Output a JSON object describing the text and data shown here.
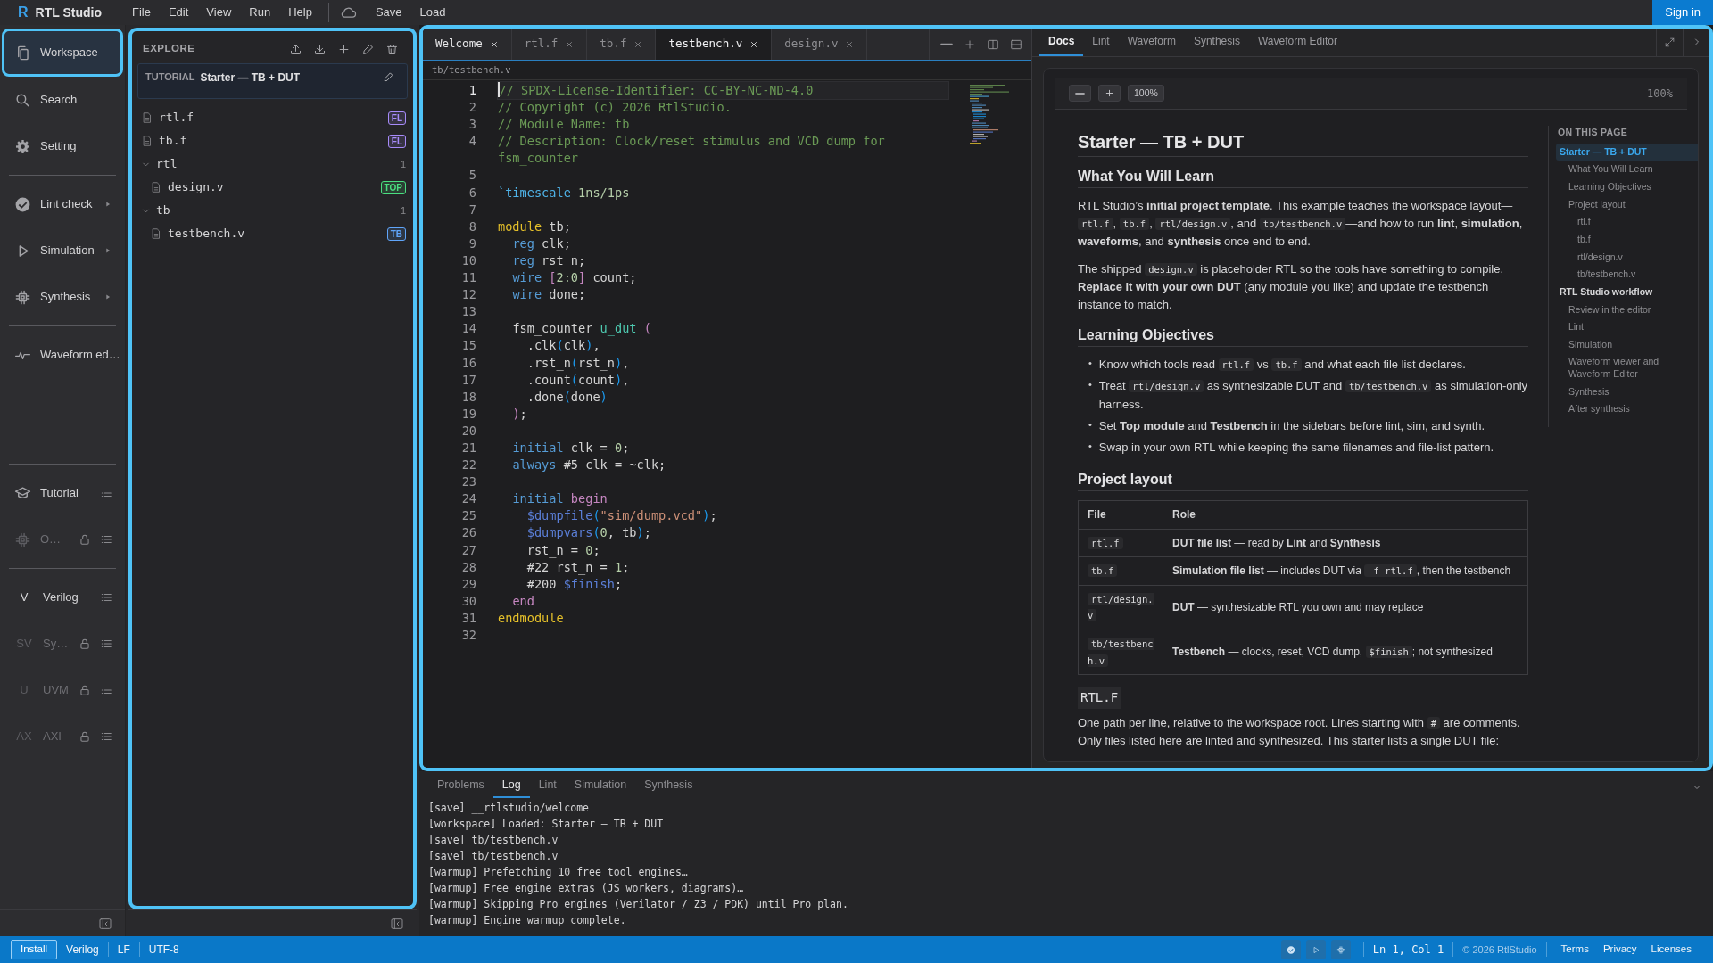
{
  "menubar": {
    "logo_mark": "R",
    "app_title": "RTL Studio",
    "menus": [
      "File",
      "Edit",
      "View",
      "Run",
      "Help"
    ],
    "actions": [
      "Save",
      "Load"
    ],
    "sign_in": "Sign in"
  },
  "activity_bar": {
    "groups": [
      {
        "items": [
          {
            "label": "Workspace",
            "kind": "nav",
            "selected": true
          },
          {
            "label": "Search",
            "kind": "nav",
            "selected": false
          },
          {
            "label": "Setting",
            "kind": "nav",
            "selected": false
          }
        ]
      },
      {
        "items": [
          {
            "label": "Lint check",
            "kind": "tool",
            "selected": false
          },
          {
            "label": "Simulation",
            "kind": "tool",
            "selected": false
          },
          {
            "label": "Synthesis",
            "kind": "tool",
            "selected": false
          }
        ]
      },
      {
        "items": [
          {
            "label": "Waveform ed…",
            "kind": "tool",
            "selected": false
          }
        ]
      },
      {
        "items": [
          {
            "label": "Tutorial",
            "kind": "pack",
            "selected": false,
            "locked": false
          },
          {
            "label": "O…",
            "kind": "pack",
            "selected": false,
            "locked": true
          }
        ]
      },
      {
        "items": [
          {
            "label": "Verilog",
            "kind": "pack",
            "badge": "V",
            "selected": false,
            "locked": false
          },
          {
            "label": "Sy…",
            "kind": "pack",
            "badge": "SV",
            "selected": false,
            "locked": true
          },
          {
            "label": "UVM",
            "kind": "pack",
            "badge": "U",
            "selected": false,
            "locked": true
          },
          {
            "label": "AXI",
            "kind": "pack",
            "badge": "AX",
            "selected": false,
            "locked": true
          }
        ]
      }
    ]
  },
  "explorer": {
    "title": "EXPLORE",
    "tutorial": {
      "tag": "TUTORIAL",
      "name": "Starter — TB + DUT"
    },
    "tree": [
      {
        "kind": "file",
        "name": "rtl.f",
        "tag": {
          "text": "FL",
          "color": "#a78bfa"
        }
      },
      {
        "kind": "file",
        "name": "tb.f",
        "tag": {
          "text": "FL",
          "color": "#a78bfa"
        }
      },
      {
        "kind": "folder",
        "name": "rtl",
        "count": "1",
        "expanded": true,
        "children": [
          {
            "kind": "file",
            "name": "design.v",
            "tag": {
              "text": "TOP",
              "color": "#4ade80"
            }
          }
        ]
      },
      {
        "kind": "folder",
        "name": "tb",
        "count": "1",
        "expanded": true,
        "children": [
          {
            "kind": "file",
            "name": "testbench.v",
            "tag": {
              "text": "TB",
              "color": "#60a5fa"
            }
          }
        ]
      }
    ]
  },
  "editor": {
    "tabs": [
      {
        "label": "Welcome",
        "selected": false
      },
      {
        "label": "rtl.f",
        "selected": false
      },
      {
        "label": "tb.f",
        "selected": false
      },
      {
        "label": "testbench.v",
        "selected": true
      },
      {
        "label": "design.v",
        "selected": false
      }
    ],
    "breadcrumb": "tb/testbench.v",
    "lines": [
      {
        "number": "1",
        "current": true,
        "tokens": [
          {
            "kind": "comment",
            "text": "// SPDX-License-Identifier: CC-BY-NC-ND-4.0"
          }
        ]
      },
      {
        "number": "2",
        "current": false,
        "tokens": [
          {
            "kind": "comment",
            "text": "// Copyright (c) 2026 RtlStudio."
          }
        ]
      },
      {
        "number": "3",
        "current": false,
        "tokens": [
          {
            "kind": "comment",
            "text": "// Module Name: tb"
          }
        ]
      },
      {
        "number": "4",
        "current": false,
        "tokens": [
          {
            "kind": "comment",
            "text": "// Description: Clock/reset stimulus and VCD dump for fsm_counter"
          }
        ]
      },
      {
        "number": "5",
        "current": false
      },
      {
        "number": "6",
        "current": false,
        "tokens": [
          {
            "kind": "directive",
            "text": "`timescale "
          },
          {
            "kind": "number",
            "text": "1ns/1ps"
          }
        ]
      },
      {
        "number": "7",
        "current": false
      },
      {
        "number": "8",
        "current": false,
        "tokens": [
          {
            "kind": "module",
            "text": "module"
          },
          {
            "kind": "plain",
            "text": " tb;"
          }
        ]
      },
      {
        "number": "9",
        "current": false,
        "tokens": [
          {
            "kind": "keyword",
            "text": "  reg"
          },
          {
            "kind": "plain",
            "text": " clk;"
          }
        ]
      },
      {
        "number": "10",
        "current": false,
        "tokens": [
          {
            "kind": "keyword",
            "text": "  reg"
          },
          {
            "kind": "plain",
            "text": " rst_n;"
          }
        ]
      },
      {
        "number": "11",
        "current": false,
        "tokens": [
          {
            "kind": "keyword",
            "text": "  wire "
          },
          {
            "kind": "bracket",
            "text": "["
          },
          {
            "kind": "number",
            "text": "2:0"
          },
          {
            "kind": "bracket",
            "text": "]"
          },
          {
            "kind": "plain",
            "text": " count;"
          }
        ]
      },
      {
        "number": "12",
        "current": false,
        "tokens": [
          {
            "kind": "keyword",
            "text": "  wire"
          },
          {
            "kind": "plain",
            "text": " done;"
          }
        ]
      },
      {
        "number": "13",
        "current": false
      },
      {
        "number": "14",
        "current": false,
        "tokens": [
          {
            "kind": "plain",
            "text": "  fsm_counter "
          },
          {
            "kind": "instance",
            "text": "u_dut "
          },
          {
            "kind": "bracket",
            "text": "("
          }
        ]
      },
      {
        "number": "15",
        "current": false,
        "tokens": [
          {
            "kind": "plain",
            "text": "    .clk"
          },
          {
            "kind": "paren",
            "text": "("
          },
          {
            "kind": "plain",
            "text": "clk"
          },
          {
            "kind": "paren",
            "text": ")"
          },
          {
            "kind": "plain",
            "text": ","
          }
        ]
      },
      {
        "number": "16",
        "current": false,
        "tokens": [
          {
            "kind": "plain",
            "text": "    .rst_n"
          },
          {
            "kind": "paren",
            "text": "("
          },
          {
            "kind": "plain",
            "text": "rst_n"
          },
          {
            "kind": "paren",
            "text": ")"
          },
          {
            "kind": "plain",
            "text": ","
          }
        ]
      },
      {
        "number": "17",
        "current": false,
        "tokens": [
          {
            "kind": "plain",
            "text": "    .count"
          },
          {
            "kind": "paren",
            "text": "("
          },
          {
            "kind": "plain",
            "text": "count"
          },
          {
            "kind": "paren",
            "text": ")"
          },
          {
            "kind": "plain",
            "text": ","
          }
        ]
      },
      {
        "number": "18",
        "current": false,
        "tokens": [
          {
            "kind": "plain",
            "text": "    .done"
          },
          {
            "kind": "paren",
            "text": "("
          },
          {
            "kind": "plain",
            "text": "done"
          },
          {
            "kind": "paren",
            "text": ")"
          }
        ]
      },
      {
        "number": "19",
        "current": false,
        "tokens": [
          {
            "kind": "bracket",
            "text": "  )"
          },
          {
            "kind": "plain",
            "text": ";"
          }
        ]
      },
      {
        "number": "20",
        "current": false
      },
      {
        "number": "21",
        "current": false,
        "tokens": [
          {
            "kind": "keyword",
            "text": "  initial"
          },
          {
            "kind": "plain",
            "text": " clk = "
          },
          {
            "kind": "number",
            "text": "0"
          },
          {
            "kind": "plain",
            "text": ";"
          }
        ]
      },
      {
        "number": "22",
        "current": false,
        "tokens": [
          {
            "kind": "keyword",
            "text": "  always"
          },
          {
            "kind": "plain",
            "text": " #5 clk = ~clk;"
          }
        ]
      },
      {
        "number": "23",
        "current": false
      },
      {
        "number": "24",
        "current": false,
        "tokens": [
          {
            "kind": "keyword",
            "text": "  initial "
          },
          {
            "kind": "bracket",
            "text": "begin"
          }
        ]
      },
      {
        "number": "25",
        "current": false,
        "tokens": [
          {
            "kind": "system",
            "text": "    $dumpfile"
          },
          {
            "kind": "paren",
            "text": "("
          },
          {
            "kind": "string",
            "text": "\"sim/dump.vcd\""
          },
          {
            "kind": "paren",
            "text": ")"
          },
          {
            "kind": "plain",
            "text": ";"
          }
        ]
      },
      {
        "number": "26",
        "current": false,
        "tokens": [
          {
            "kind": "system",
            "text": "    $dumpvars"
          },
          {
            "kind": "paren",
            "text": "("
          },
          {
            "kind": "number",
            "text": "0"
          },
          {
            "kind": "plain",
            "text": ", tb"
          },
          {
            "kind": "paren",
            "text": ")"
          },
          {
            "kind": "plain",
            "text": ";"
          }
        ]
      },
      {
        "number": "27",
        "current": false,
        "tokens": [
          {
            "kind": "plain",
            "text": "    rst_n = "
          },
          {
            "kind": "number",
            "text": "0"
          },
          {
            "kind": "plain",
            "text": ";"
          }
        ]
      },
      {
        "number": "28",
        "current": false,
        "tokens": [
          {
            "kind": "plain",
            "text": "    #22 rst_n = "
          },
          {
            "kind": "number",
            "text": "1"
          },
          {
            "kind": "plain",
            "text": ";"
          }
        ]
      },
      {
        "number": "29",
        "current": false,
        "tokens": [
          {
            "kind": "plain",
            "text": "    #200 "
          },
          {
            "kind": "system",
            "text": "$finish"
          },
          {
            "kind": "plain",
            "text": ";"
          }
        ]
      },
      {
        "number": "30",
        "current": false,
        "tokens": [
          {
            "kind": "bracket",
            "text": "  end"
          }
        ]
      },
      {
        "number": "31",
        "current": false,
        "tokens": [
          {
            "kind": "module",
            "text": "endmodule"
          }
        ]
      },
      {
        "number": "32",
        "current": false
      }
    ]
  },
  "docs": {
    "tabs": [
      {
        "label": "Docs",
        "selected": true
      },
      {
        "label": "Lint",
        "selected": false
      },
      {
        "label": "Waveform",
        "selected": false
      },
      {
        "label": "Synthesis",
        "selected": false
      },
      {
        "label": "Waveform Editor",
        "selected": false
      }
    ],
    "zoom_button": "100%",
    "zoom_reading": "100%",
    "blocks": [
      {
        "kind": "h1",
        "text": "Starter — TB + DUT"
      },
      {
        "kind": "h2",
        "text": "What You Will Learn"
      },
      {
        "kind": "p",
        "segments": [
          {
            "kind": "text",
            "text": "RTL Studio’s **initial project template**. This example teaches the workspace layout—"
          },
          {
            "kind": "code",
            "text": "rtl.f"
          },
          {
            "kind": "text",
            "text": ", "
          },
          {
            "kind": "code",
            "text": "tb.f"
          },
          {
            "kind": "text",
            "text": ", "
          },
          {
            "kind": "code",
            "text": "rtl/design.v"
          },
          {
            "kind": "text",
            "text": ", and "
          },
          {
            "kind": "code",
            "text": "tb/testbench.v"
          },
          {
            "kind": "text",
            "text": "—and how to run **lint**, **simulation**, **waveforms**, and **synthesis** once end to end."
          }
        ]
      },
      {
        "kind": "p",
        "segments": [
          {
            "kind": "text",
            "text": "The shipped "
          },
          {
            "kind": "code",
            "text": "design.v"
          },
          {
            "kind": "text",
            "text": " is placeholder RTL so the tools have something to compile. **Replace it with your own DUT** (any module you like) and update the testbench instance to match."
          }
        ]
      },
      {
        "kind": "h2",
        "text": "Learning Objectives"
      },
      {
        "kind": "ul",
        "items": [
          {
            "marker": "•",
            "segments": [
              {
                "kind": "text",
                "text": "Know which tools read "
              },
              {
                "kind": "code",
                "text": "rtl.f"
              },
              {
                "kind": "text",
                "text": " vs "
              },
              {
                "kind": "code",
                "text": "tb.f"
              },
              {
                "kind": "text",
                "text": " and what each file list declares."
              }
            ]
          },
          {
            "marker": "•",
            "segments": [
              {
                "kind": "text",
                "text": "Treat "
              },
              {
                "kind": "code",
                "text": "rtl/design.v"
              },
              {
                "kind": "text",
                "text": " as synthesizable DUT and "
              },
              {
                "kind": "code",
                "text": "tb/testbench.v"
              },
              {
                "kind": "text",
                "text": " as simulation-only harness."
              }
            ]
          },
          {
            "marker": "•",
            "segments": [
              {
                "kind": "text",
                "text": "Set **Top module** and **Testbench** in the sidebars before lint, sim, and synth."
              }
            ]
          },
          {
            "marker": "•",
            "segments": [
              {
                "kind": "text",
                "text": "Swap in your own RTL while keeping the same filenames and file-list pattern."
              }
            ]
          }
        ]
      },
      {
        "kind": "h2",
        "text": "Project layout"
      },
      {
        "kind": "table",
        "columns": [
          "File",
          "Role"
        ],
        "rows": [
          {
            "file": "rtl.f",
            "role": [
              {
                "kind": "text",
                "text": "**DUT file list** — read by **Lint** and **Synthesis**"
              }
            ]
          },
          {
            "file": "tb.f",
            "role": [
              {
                "kind": "text",
                "text": "**Simulation file list** — includes DUT via "
              },
              {
                "kind": "code",
                "text": "-f rtl.f"
              },
              {
                "kind": "text",
                "text": ", then the testbench"
              }
            ]
          },
          {
            "file": "rtl/design.v",
            "role": [
              {
                "kind": "text",
                "text": "**DUT** — synthesizable RTL you own and may replace"
              }
            ]
          },
          {
            "file": "tb/testbench.v",
            "role": [
              {
                "kind": "text",
                "text": "**Testbench** — clocks, reset, VCD dump, "
              },
              {
                "kind": "code",
                "text": "$finish"
              },
              {
                "kind": "text",
                "text": "; not synthesized"
              }
            ]
          }
        ]
      },
      {
        "kind": "h3",
        "text": "RTL.F"
      },
      {
        "kind": "p",
        "segments": [
          {
            "kind": "text",
            "text": "One path per line, relative to the workspace root. Lines starting with "
          },
          {
            "kind": "code",
            "text": "#"
          },
          {
            "kind": "text",
            "text": " are comments. Only files listed here are linted and synthesized. This starter lists a single DUT file:"
          }
        ]
      }
    ],
    "toc_title": "ON THIS PAGE",
    "toc": [
      {
        "label": "Starter — TB + DUT",
        "selected": true,
        "children": [
          {
            "label": "What You Will Learn",
            "selected": false
          },
          {
            "label": "Learning Objectives",
            "selected": false
          },
          {
            "label": "Project layout",
            "selected": false,
            "children": [
              {
                "label": "rtl.f",
                "selected": false
              },
              {
                "label": "tb.f",
                "selected": false
              },
              {
                "label": "rtl/design.v",
                "selected": false
              },
              {
                "label": "tb/testbench.v",
                "selected": false
              }
            ]
          }
        ]
      },
      {
        "label": "RTL Studio workflow",
        "selected": false,
        "children": [
          {
            "label": "Review in the editor",
            "selected": false
          },
          {
            "label": "Lint",
            "selected": false
          },
          {
            "label": "Simulation",
            "selected": false
          },
          {
            "label": "Waveform viewer and Waveform Editor",
            "selected": false
          },
          {
            "label": "Synthesis",
            "selected": false
          },
          {
            "label": "After synthesis",
            "selected": false
          }
        ]
      }
    ]
  },
  "bottom_panel": {
    "tabs": [
      {
        "label": "Problems",
        "selected": false
      },
      {
        "label": "Log",
        "selected": true
      },
      {
        "label": "Lint",
        "selected": false
      },
      {
        "label": "Simulation",
        "selected": false
      },
      {
        "label": "Synthesis",
        "selected": false
      }
    ],
    "log": [
      "[save] __rtlstudio/welcome",
      "[workspace] Loaded: Starter — TB + DUT",
      "[save] tb/testbench.v",
      "[save] tb/testbench.v",
      "[warmup] Prefetching 10 free tool engines…",
      "[warmup] Free engine extras (JS workers, diagrams)…",
      "[warmup] Skipping Pro engines (Verilator / Z3 / PDK) until Pro plan.",
      "[warmup] Engine warmup complete."
    ]
  },
  "status_bar": {
    "install": "Install",
    "left": [
      "Verilog",
      "LF",
      "UTF-8"
    ],
    "position": "Ln 1, Col 1",
    "copyright": "© 2026 RtlStudio",
    "links": [
      "Terms",
      "Privacy",
      "Licenses"
    ]
  }
}
